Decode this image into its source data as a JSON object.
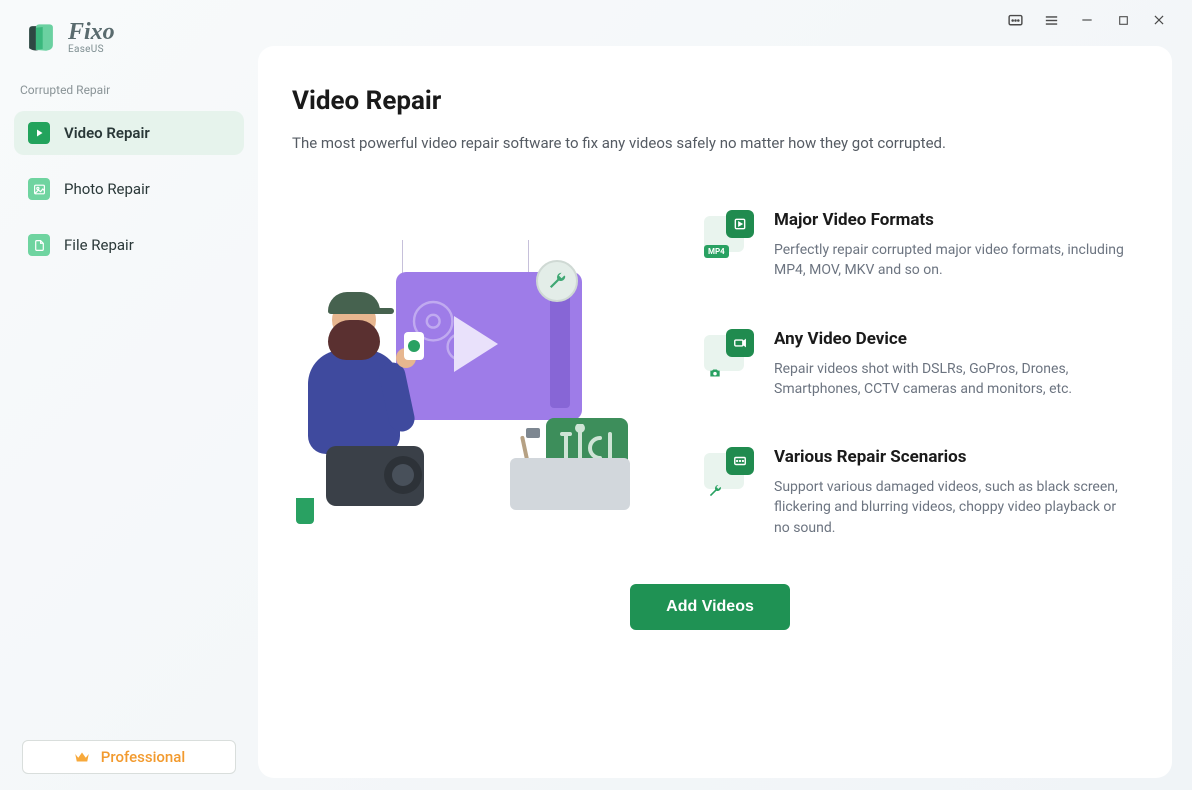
{
  "app": {
    "name": "Fixo",
    "vendor": "EaseUS"
  },
  "sidebar": {
    "section_label": "Corrupted Repair",
    "items": [
      {
        "label": "Video Repair",
        "active": true
      },
      {
        "label": "Photo Repair",
        "active": false
      },
      {
        "label": "File Repair",
        "active": false
      }
    ],
    "professional_label": "Professional"
  },
  "main": {
    "title": "Video Repair",
    "subtitle": "The most powerful video repair software to fix any videos safely no matter how they got corrupted.",
    "features": [
      {
        "title": "Major Video Formats",
        "desc": "Perfectly repair corrupted major video formats, including MP4, MOV, MKV and so on.",
        "badge": "MP4"
      },
      {
        "title": "Any Video Device",
        "desc": "Repair videos shot with DSLRs, GoPros, Drones, Smartphones, CCTV cameras and monitors, etc."
      },
      {
        "title": "Various Repair Scenarios",
        "desc": "Support various damaged videos, such as black screen, flickering and blurring videos, choppy video playback or no sound."
      }
    ],
    "cta_label": "Add Videos"
  },
  "colors": {
    "accent_green": "#1f9254",
    "nav_active_bg": "#e6f3ec",
    "pro_orange": "#f29a2e"
  }
}
